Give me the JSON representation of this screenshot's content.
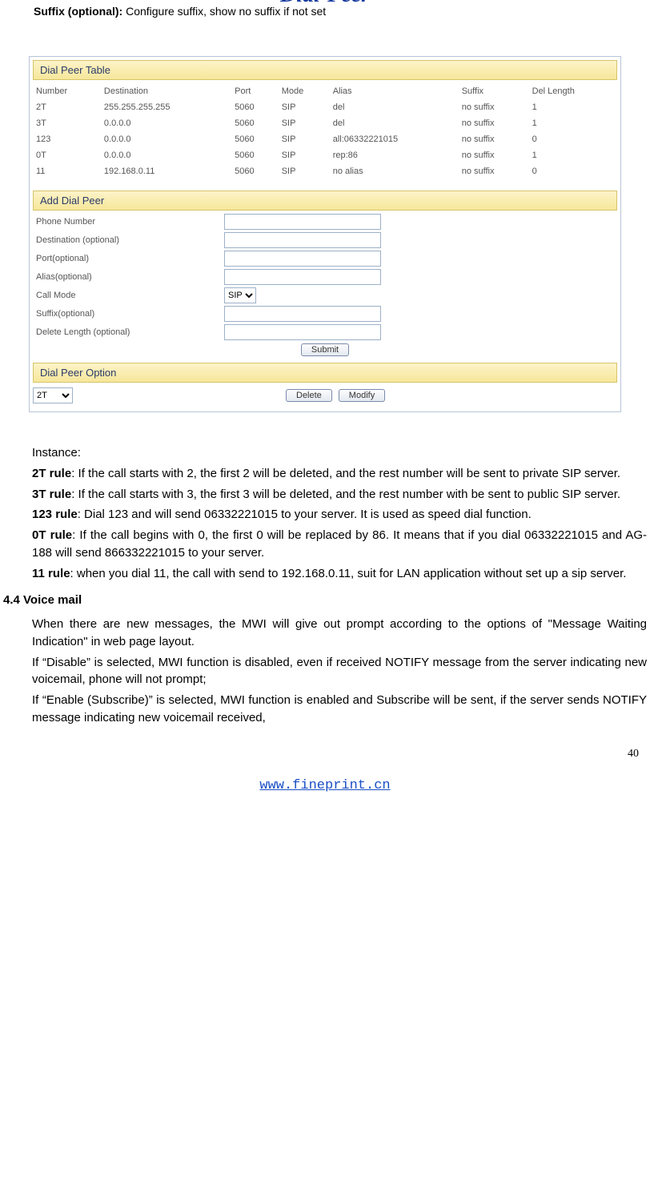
{
  "suffix_line": {
    "bold": "Suffix (optional):",
    "rest": " Configure suffix, show no suffix if not set"
  },
  "panel": {
    "title": "Dial-Peer",
    "table_header": "Dial Peer Table",
    "columns": [
      "Number",
      "Destination",
      "Port",
      "Mode",
      "Alias",
      "Suffix",
      "Del Length"
    ],
    "rows": [
      [
        "2T",
        "255.255.255.255",
        "5060",
        "SIP",
        "del",
        "no suffix",
        "1"
      ],
      [
        "3T",
        "0.0.0.0",
        "5060",
        "SIP",
        "del",
        "no suffix",
        "1"
      ],
      [
        "123",
        "0.0.0.0",
        "5060",
        "SIP",
        "all:06332221015",
        "no suffix",
        "0"
      ],
      [
        "0T",
        "0.0.0.0",
        "5060",
        "SIP",
        "rep:86",
        "no suffix",
        "1"
      ],
      [
        "11",
        "192.168.0.11",
        "5060",
        "SIP",
        "no alias",
        "no suffix",
        "0"
      ]
    ],
    "add_header": "Add Dial Peer",
    "form": {
      "phone_label": "Phone Number",
      "dest_label": "Destination (optional)",
      "port_label": "Port(optional)",
      "alias_label": "Alias(optional)",
      "mode_label": "Call Mode",
      "mode_value": "SIP",
      "suffix_label": "Suffix(optional)",
      "dellen_label": "Delete Length (optional)",
      "submit": "Submit"
    },
    "option_header": "Dial Peer Option",
    "option_select": "2T",
    "delete_btn": "Delete",
    "modify_btn": "Modify"
  },
  "body": {
    "instance": "Instance:",
    "r2t_b": "2T rule",
    "r2t": ": If the call starts with 2, the first 2 will be deleted, and the rest number will be sent to private SIP server.",
    "r3t_b": "3T rule",
    "r3t": ": If the call starts with 3, the first 3 will be deleted, and the rest number with be sent to public SIP server.",
    "r123_b": "123 rule",
    "r123": ": Dial 123 and will send 06332221015 to your server. It is used as speed dial function.",
    "r0t_b": "0T rule",
    "r0t": ": If the call begins with 0, the first 0 will be replaced by 86. It means that if you dial 06332221015 and AG-188 will send 866332221015 to your server.",
    "r11_b": "11 rule",
    "r11": ": when you dial 11, the call with send to 192.168.0.11, suit for LAN application without set up a sip server.",
    "voice_heading": "4.4 Voice mail",
    "vm1": "When there are new messages, the MWI will give out prompt according to the options of \"Message Waiting Indication\" in web page layout.",
    "vm2": "If “Disable” is selected, MWI function is disabled, even if received NOTIFY message from the server indicating new voicemail, phone will not prompt;",
    "vm3": "If “Enable (Subscribe)” is selected, MWI function is enabled and Subscribe will be sent, if the server sends NOTIFY message indicating new voicemail received,"
  },
  "page_number": "40",
  "footer_url": "www.fineprint.cn"
}
